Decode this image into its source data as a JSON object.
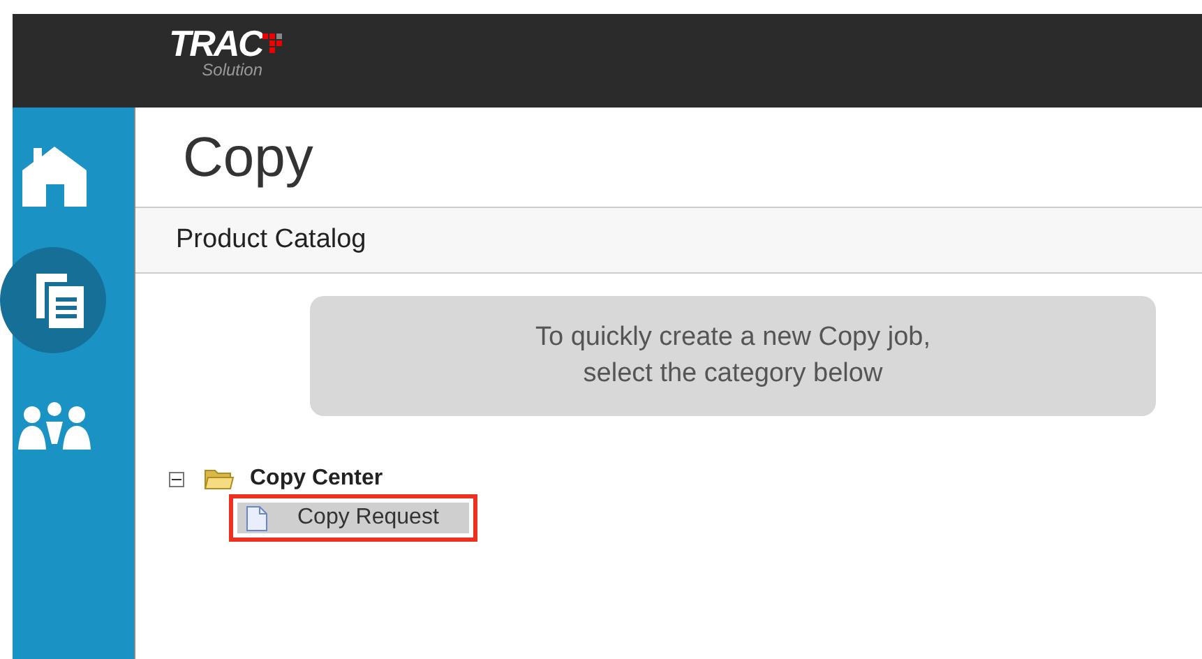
{
  "logo": {
    "text": "TRAC",
    "subtitle": "Solution"
  },
  "sidebar": {
    "items": [
      {
        "kind": "home",
        "selected": false
      },
      {
        "kind": "copy",
        "selected": true
      },
      {
        "kind": "people",
        "selected": false
      }
    ]
  },
  "page": {
    "title": "Copy",
    "section": "Product Catalog",
    "hint": [
      "To quickly create a new Copy job,",
      "select the category below"
    ]
  },
  "tree": [
    {
      "label": "Copy Center",
      "expanded": true,
      "children": [
        {
          "label": "Copy Request",
          "selected": true,
          "annotated": true
        }
      ]
    }
  ]
}
